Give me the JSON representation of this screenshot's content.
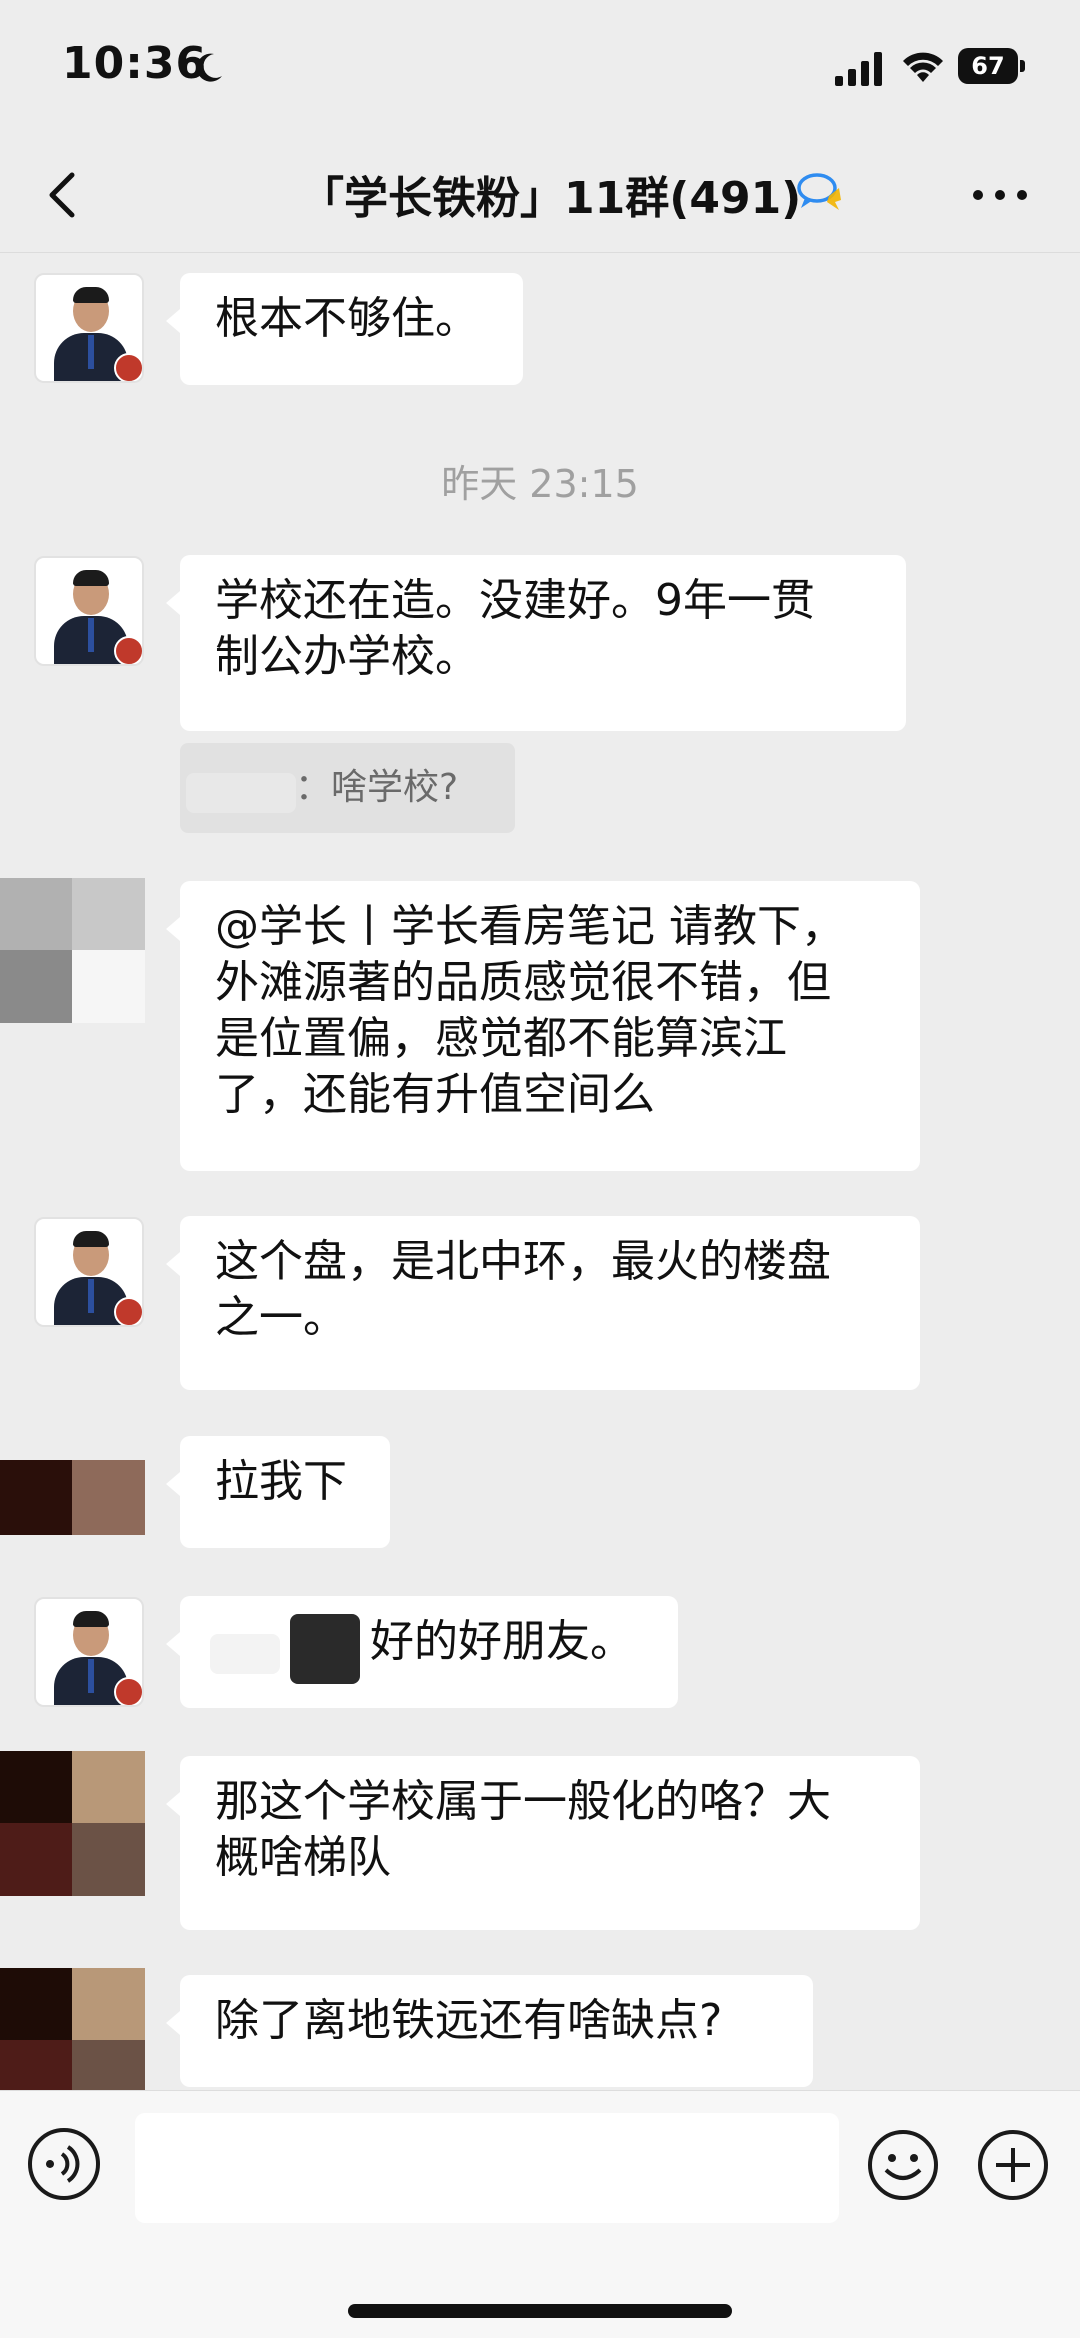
{
  "status_bar": {
    "time": "10:36",
    "battery": "67",
    "icons": [
      "moon-icon",
      "signal-icon",
      "wifi-icon",
      "battery-icon"
    ]
  },
  "nav": {
    "title": "「学长铁粉」11群(491)",
    "icons": [
      "back-arrow-icon",
      "chat-bubbles-icon",
      "more-dots-icon"
    ]
  },
  "messages": [
    {
      "sender": "self",
      "text_lines": [
        "根本不够住。"
      ]
    },
    {
      "type": "timestamp",
      "text": "昨天 23:15"
    },
    {
      "sender": "self",
      "text_lines": [
        "学校还在造。没建好。9年一贯",
        "制公办学校。"
      ]
    },
    {
      "type": "quote",
      "text": "：啥学校?"
    },
    {
      "sender": "other",
      "text_lines": [
        "@学长丨学长看房笔记 请教下，",
        "外滩源著的品质感觉很不错，但",
        "是位置偏，感觉都不能算滨江",
        "了，还能有升值空间么"
      ]
    },
    {
      "sender": "self",
      "text_lines": [
        "这个盘，是北中环，最火的楼盘",
        "之一。"
      ]
    },
    {
      "sender": "other",
      "text_lines": [
        "拉我下"
      ]
    },
    {
      "sender": "self",
      "text_lines": [
        "好的好朋友。"
      ]
    },
    {
      "sender": "other",
      "text_lines": [
        "那这个学校属于一般化的咯？大",
        "概啥梯队"
      ]
    },
    {
      "sender": "other",
      "text_lines": [
        "除了离地铁远还有啥缺点?"
      ]
    }
  ],
  "colors": {
    "background": "#ededed",
    "bubble": "#ffffff",
    "timestamp_text": "#a0a0a0",
    "accent_blue": "#2f8cf0"
  }
}
